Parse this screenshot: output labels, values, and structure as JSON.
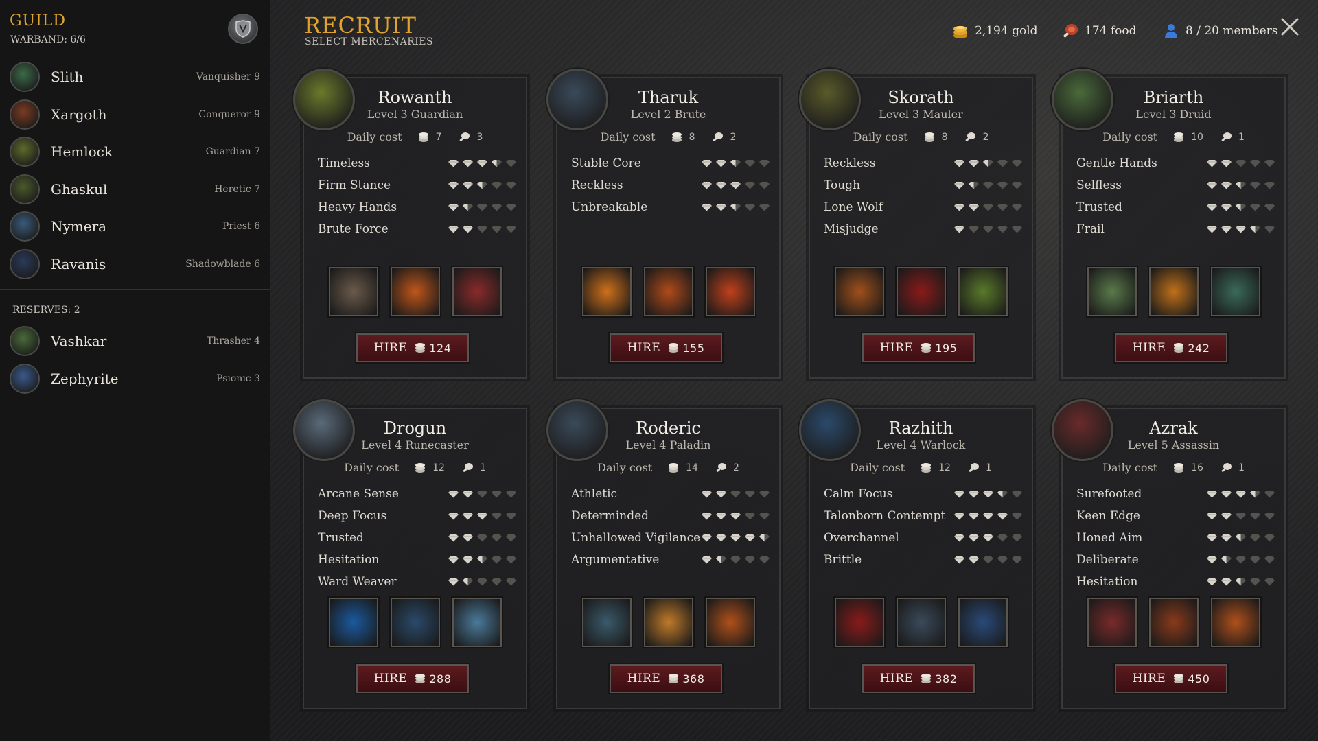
{
  "sidebar": {
    "title": "GUILD",
    "warband_label": "WARBAND: 6/6",
    "roster": [
      {
        "name": "Slith",
        "class": "Vanquisher 9",
        "avatar_color": "#3a6a48"
      },
      {
        "name": "Xargoth",
        "class": "Conqueror 9",
        "avatar_color": "#7a3a22"
      },
      {
        "name": "Hemlock",
        "class": "Guardian 7",
        "avatar_color": "#5e6a2a"
      },
      {
        "name": "Ghaskul",
        "class": "Heretic 7",
        "avatar_color": "#4a5a2a"
      },
      {
        "name": "Nymera",
        "class": "Priest 6",
        "avatar_color": "#3a5a7a"
      },
      {
        "name": "Ravanis",
        "class": "Shadowblade 6",
        "avatar_color": "#2a3a5a"
      }
    ],
    "reserves_label": "RESERVES: 2",
    "reserves": [
      {
        "name": "Vashkar",
        "class": "Thrasher 4",
        "avatar_color": "#4a6a3a"
      },
      {
        "name": "Zephyrite",
        "class": "Psionic 3",
        "avatar_color": "#3a5a8a"
      }
    ]
  },
  "header": {
    "title": "RECRUIT",
    "subtitle": "SELECT MERCENARIES",
    "gold": "2,194 gold",
    "food": "174 food",
    "members": "8 / 20 members"
  },
  "colors": {
    "accent": "#e0a32e",
    "hire_button": "#5c1b1f",
    "pip": "#d8d4cc",
    "pip_empty": "#55534f"
  },
  "common": {
    "daily_cost_label": "Daily cost",
    "hire_label": "HIRE"
  },
  "mercenaries": [
    {
      "name": "Rowanth",
      "level": "Level 3 Guardian",
      "gold_cost": "7",
      "food_cost": "3",
      "price": "124",
      "portrait_color": "#6a7a2a",
      "traits": [
        {
          "name": "Timeless",
          "rating": 3.5
        },
        {
          "name": "Firm Stance",
          "rating": 2.5
        },
        {
          "name": "Heavy Hands",
          "rating": 1.5
        },
        {
          "name": "Brute Force",
          "rating": 2
        }
      ],
      "skills": [
        "shield-bash-skill-icon",
        "flame-ring-skill-icon",
        "rending-strike-skill-icon"
      ],
      "skill_colors": [
        "#6a5a4a",
        "#c0561a",
        "#8a2a2a"
      ]
    },
    {
      "name": "Tharuk",
      "level": "Level 2 Brute",
      "gold_cost": "8",
      "food_cost": "2",
      "price": "155",
      "portrait_color": "#3a4a5a",
      "traits": [
        {
          "name": "Stable Core",
          "rating": 2.5
        },
        {
          "name": "Reckless",
          "rating": 3
        },
        {
          "name": "Unbreakable",
          "rating": 2.5
        }
      ],
      "skills": [
        "fire-punch-skill-icon",
        "blazing-axe-skill-icon",
        "inferno-slash-skill-icon"
      ],
      "skill_colors": [
        "#d0701a",
        "#b04a1a",
        "#c0401a"
      ]
    },
    {
      "name": "Skorath",
      "level": "Level 3 Mauler",
      "gold_cost": "8",
      "food_cost": "2",
      "price": "195",
      "portrait_color": "#5a5a2a",
      "traits": [
        {
          "name": "Reckless",
          "rating": 2.5
        },
        {
          "name": "Tough",
          "rating": 1.5
        },
        {
          "name": "Lone Wolf",
          "rating": 2
        },
        {
          "name": "Misjudge",
          "rating": 1
        }
      ],
      "skills": [
        "claw-swipe-skill-icon",
        "blood-claws-skill-icon",
        "venom-spit-skill-icon"
      ],
      "skill_colors": [
        "#a0501a",
        "#8a1a1a",
        "#5a7a2a"
      ]
    },
    {
      "name": "Briarth",
      "level": "Level 3 Druid",
      "gold_cost": "10",
      "food_cost": "1",
      "price": "242",
      "portrait_color": "#4a6a3a",
      "traits": [
        {
          "name": "Gentle Hands",
          "rating": 2
        },
        {
          "name": "Selfless",
          "rating": 2.5
        },
        {
          "name": "Trusted",
          "rating": 2.5
        },
        {
          "name": "Frail",
          "rating": 3.5
        }
      ],
      "skills": [
        "sprouting-seed-skill-icon",
        "burning-aura-skill-icon",
        "spirit-form-skill-icon"
      ],
      "skill_colors": [
        "#5a7a4a",
        "#c0701a",
        "#3a6a5a"
      ]
    },
    {
      "name": "Drogun",
      "level": "Level 4 Runecaster",
      "gold_cost": "12",
      "food_cost": "1",
      "price": "288",
      "portrait_color": "#5a6a7a",
      "traits": [
        {
          "name": "Arcane Sense",
          "rating": 2
        },
        {
          "name": "Deep Focus",
          "rating": 3
        },
        {
          "name": "Trusted",
          "rating": 2
        },
        {
          "name": "Hesitation",
          "rating": 2.5
        },
        {
          "name": "Ward Weaver",
          "rating": 1.5
        }
      ],
      "skills": [
        "frost-rune-skill-icon",
        "rune-burst-skill-icon",
        "ice-crystals-skill-icon"
      ],
      "skill_colors": [
        "#1a5aa0",
        "#2a4a6a",
        "#4a7a9a"
      ]
    },
    {
      "name": "Roderic",
      "level": "Level 4 Paladin",
      "gold_cost": "14",
      "food_cost": "2",
      "price": "368",
      "portrait_color": "#3a4a5a",
      "traits": [
        {
          "name": "Athletic",
          "rating": 2
        },
        {
          "name": "Determinded",
          "rating": 3
        },
        {
          "name": "Unhallowed Vigilance",
          "rating": 4.5
        },
        {
          "name": "Argumentative",
          "rating": 1.5
        }
      ],
      "skills": [
        "gauntlet-block-skill-icon",
        "sun-shield-skill-icon",
        "holy-sword-skill-icon"
      ],
      "skill_colors": [
        "#3a5a6a",
        "#c07a2a",
        "#b0501a"
      ]
    },
    {
      "name": "Razhith",
      "level": "Level 4 Warlock",
      "gold_cost": "12",
      "food_cost": "1",
      "price": "382",
      "portrait_color": "#2a4a6a",
      "traits": [
        {
          "name": "Calm Focus",
          "rating": 3.5
        },
        {
          "name": "Talonborn Contempt",
          "rating": 4
        },
        {
          "name": "Overchannel",
          "rating": 3
        },
        {
          "name": "Brittle",
          "rating": 2
        }
      ],
      "skills": [
        "blood-orb-skill-icon",
        "armored-legs-skill-icon",
        "shadow-strike-skill-icon"
      ],
      "skill_colors": [
        "#8a1a1a",
        "#3a4a5a",
        "#2a4a7a"
      ]
    },
    {
      "name": "Azrak",
      "level": "Level 5 Assassin",
      "gold_cost": "16",
      "food_cost": "1",
      "price": "450",
      "portrait_color": "#6a2a2a",
      "traits": [
        {
          "name": "Surefooted",
          "rating": 3.5
        },
        {
          "name": "Keen Edge",
          "rating": 2
        },
        {
          "name": "Honed Aim",
          "rating": 2.5
        },
        {
          "name": "Deliberate",
          "rating": 1.5
        },
        {
          "name": "Hesitation",
          "rating": 2.5
        }
      ],
      "skills": [
        "trident-strike-skill-icon",
        "piercing-bolts-skill-icon",
        "fire-claws-skill-icon"
      ],
      "skill_colors": [
        "#7a2a2a",
        "#8a3a1a",
        "#b0501a"
      ]
    }
  ]
}
